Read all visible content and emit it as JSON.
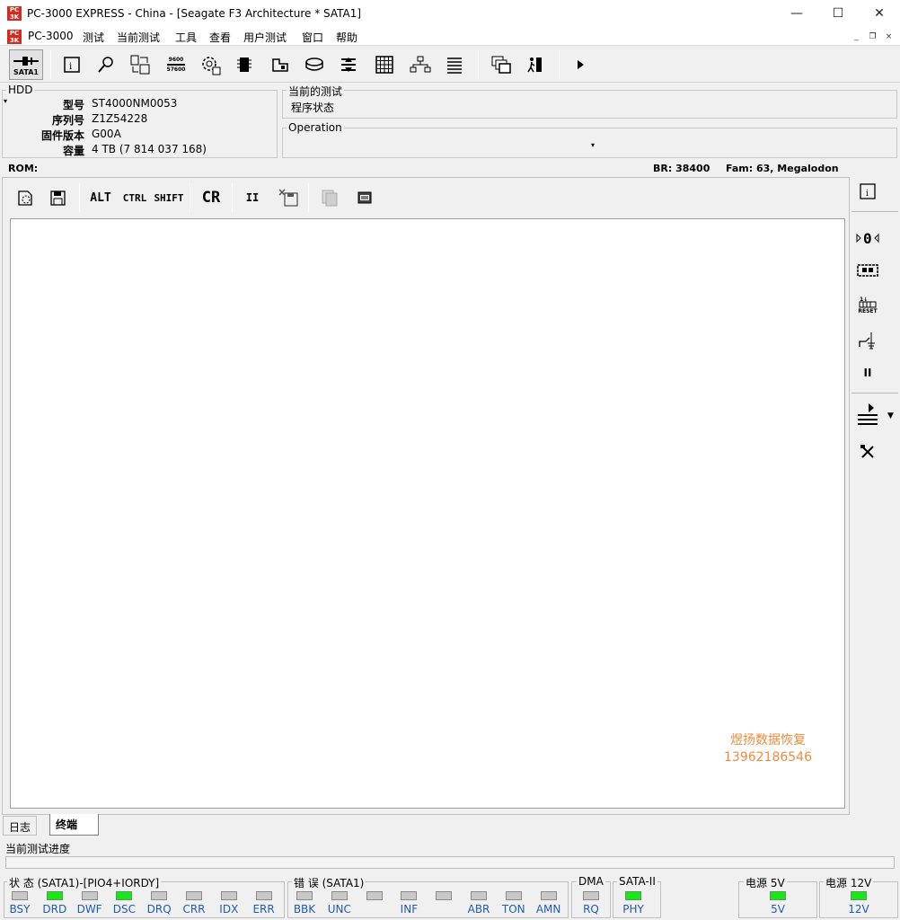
{
  "window": {
    "title": "PC-3000 EXPRESS - China - [Seagate F3 Architecture * SATA1]",
    "app_icon_text": "PC 3K",
    "controls": {
      "minimize": "—",
      "maximize": "☐",
      "close": "✕"
    }
  },
  "menu": {
    "items": [
      "PC-3000",
      "测试",
      "当前测试",
      "工具",
      "查看",
      "用户测试",
      "窗口",
      "帮助"
    ],
    "mdi": {
      "minimize": "_",
      "restore": "❐",
      "close": "×"
    }
  },
  "toolbar": {
    "sata_label": "SATA1",
    "baud_top": "9600",
    "baud_bottom": "57600"
  },
  "hdd": {
    "group_label": "HDD",
    "fields": [
      {
        "label": "型号",
        "value": "ST4000NM0053"
      },
      {
        "label": "序列号",
        "value": "Z1Z54228"
      },
      {
        "label": "固件版本",
        "value": "G00A"
      },
      {
        "label": "容量",
        "value": "4 TB (7 814 037 168)"
      }
    ]
  },
  "current_test": {
    "group_label": "当前的测试",
    "value": "程序状态"
  },
  "operation": {
    "group_label": "Operation",
    "value": ""
  },
  "rom_row": {
    "rom": "ROM:",
    "br": "BR: 38400",
    "fam": "Fam: 63, Megalodon"
  },
  "terminal_toolbar": {
    "alt": "ALT",
    "ctrl": "CTRL",
    "shift": "SHIFT",
    "cr": "CR",
    "pause": "II"
  },
  "watermark": {
    "line1": "煜扬数据恢复",
    "line2": "13962186546",
    "color": "#f08a3c"
  },
  "sidebar": {
    "reset_label": "RESET",
    "pause": "II"
  },
  "tabs": [
    {
      "label": "日志",
      "active": false
    },
    {
      "label": "终端",
      "active": true
    }
  ],
  "progress": {
    "label": "当前测试进度",
    "value": 0
  },
  "status": {
    "group_label": "状 态 (SATA1)-[PIO4+IORDY]",
    "leds": [
      {
        "label": "BSY",
        "on": false
      },
      {
        "label": "DRD",
        "on": true
      },
      {
        "label": "DWF",
        "on": false
      },
      {
        "label": "DSC",
        "on": true
      },
      {
        "label": "DRQ",
        "on": false
      },
      {
        "label": "CRR",
        "on": false
      },
      {
        "label": "IDX",
        "on": false
      },
      {
        "label": "ERR",
        "on": false
      }
    ]
  },
  "errors": {
    "group_label": "错 误 (SATA1)",
    "leds": [
      {
        "label": "BBK",
        "on": false
      },
      {
        "label": "UNC",
        "on": false
      },
      {
        "label": "",
        "on": false
      },
      {
        "label": "INF",
        "on": false
      },
      {
        "label": "",
        "on": false
      },
      {
        "label": "ABR",
        "on": false
      },
      {
        "label": "TON",
        "on": false
      },
      {
        "label": "AMN",
        "on": false
      }
    ]
  },
  "dma": {
    "group_label": "DMA",
    "led": {
      "label": "RQ",
      "on": false
    }
  },
  "sata2": {
    "group_label": "SATA-II",
    "led": {
      "label": "PHY",
      "on": true
    }
  },
  "power5": {
    "group_label": "电源 5V",
    "led": {
      "label": "5V",
      "on": true
    }
  },
  "power12": {
    "group_label": "电源 12V",
    "led": {
      "label": "12V",
      "on": true
    }
  },
  "colors": {
    "led_on": "#19e619",
    "led_off": "#c8c8c8",
    "led_label": "#1f5cae",
    "brand_red": "#d62a1f"
  }
}
